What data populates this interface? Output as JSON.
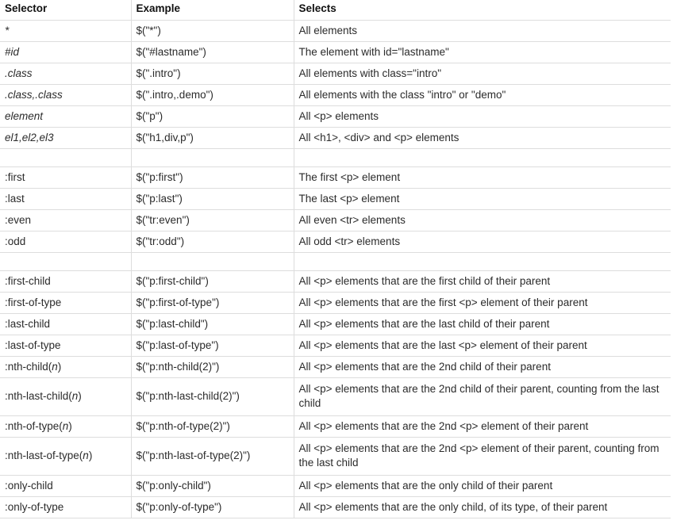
{
  "table": {
    "headers": {
      "selector": "Selector",
      "example": "Example",
      "selects": "Selects"
    },
    "rows": [
      {
        "selector": "*",
        "selector_style": "italic",
        "example": "$(\"*\")",
        "selects": "All elements"
      },
      {
        "selector": "#id",
        "selector_style": "italic",
        "example": "$(\"#lastname\")",
        "selects": "The element with id=\"lastname\""
      },
      {
        "selector": ".class",
        "selector_style": "italic",
        "example": "$(\".intro\")",
        "selects": "All elements with class=\"intro\""
      },
      {
        "selector": ".class,.class",
        "selector_style": "italic",
        "example": "$(\".intro,.demo\")",
        "selects": "All elements with the class \"intro\" or \"demo\""
      },
      {
        "selector": "element",
        "selector_style": "italic",
        "example": "$(\"p\")",
        "selects": "All <p> elements"
      },
      {
        "selector": "el1,el2,el3",
        "selector_style": "italic",
        "example": "$(\"h1,div,p\")",
        "selects": "All <h1>, <div> and <p> elements"
      },
      {
        "selector": "",
        "selector_style": "plain",
        "example": "",
        "selects": "",
        "spacer": true
      },
      {
        "selector": ":first",
        "selector_style": "plain",
        "example": "$(\"p:first\")",
        "selects": "The first <p> element"
      },
      {
        "selector": ":last",
        "selector_style": "plain",
        "example": "$(\"p:last\")",
        "selects": "The last <p> element"
      },
      {
        "selector": ":even",
        "selector_style": "plain",
        "example": "$(\"tr:even\")",
        "selects": "All even <tr> elements"
      },
      {
        "selector": ":odd",
        "selector_style": "plain",
        "example": "$(\"tr:odd\")",
        "selects": "All odd <tr> elements"
      },
      {
        "selector": "",
        "selector_style": "plain",
        "example": "",
        "selects": "",
        "spacer": true
      },
      {
        "selector": ":first-child",
        "selector_style": "plain",
        "example": "$(\"p:first-child\")",
        "selects": "All <p> elements that are the first child of their parent"
      },
      {
        "selector": ":first-of-type",
        "selector_style": "plain",
        "example": "$(\"p:first-of-type\")",
        "selects": "All <p> elements that are the first <p> element of their parent"
      },
      {
        "selector": ":last-child",
        "selector_style": "plain",
        "example": "$(\"p:last-child\")",
        "selects": "All <p> elements that are the last child of their parent"
      },
      {
        "selector": ":last-of-type",
        "selector_style": "plain",
        "example": "$(\"p:last-of-type\")",
        "selects": "All <p> elements that are the last <p> element of their parent"
      },
      {
        "selector": ":nth-child(n)",
        "selector_prefix": ":nth-child(",
        "selector_param": "n",
        "selector_suffix": ")",
        "selector_style": "param",
        "example": "$(\"p:nth-child(2)\")",
        "selects": "All <p> elements that are the 2nd child of their parent"
      },
      {
        "selector": ":nth-last-child(n)",
        "selector_prefix": ":nth-last-child(",
        "selector_param": "n",
        "selector_suffix": ")",
        "selector_style": "param",
        "example": "$(\"p:nth-last-child(2)\")",
        "selects": "All <p> elements that are the 2nd child of their parent, counting from the last child",
        "tall": true
      },
      {
        "selector": ":nth-of-type(n)",
        "selector_prefix": ":nth-of-type(",
        "selector_param": "n",
        "selector_suffix": ")",
        "selector_style": "param",
        "example": "$(\"p:nth-of-type(2)\")",
        "selects": "All <p> elements that are the 2nd <p> element of their parent"
      },
      {
        "selector": ":nth-last-of-type(n)",
        "selector_prefix": ":nth-last-of-type(",
        "selector_param": "n",
        "selector_suffix": ")",
        "selector_style": "param",
        "example": "$(\"p:nth-last-of-type(2)\")",
        "selects": "All <p> elements that are the 2nd <p> element of their parent, counting from the last child",
        "tall": true
      },
      {
        "selector": ":only-child",
        "selector_style": "plain",
        "example": "$(\"p:only-child\")",
        "selects": "All <p> elements that are the only child of their parent"
      },
      {
        "selector": ":only-of-type",
        "selector_style": "plain",
        "example": "$(\"p:only-of-type\")",
        "selects": "All <p> elements that are the only child, of its type, of their parent"
      }
    ]
  },
  "colors": {
    "border": "#dddddd",
    "text": "#2b2b2b",
    "header_text": "#111111",
    "background": "#ffffff"
  }
}
